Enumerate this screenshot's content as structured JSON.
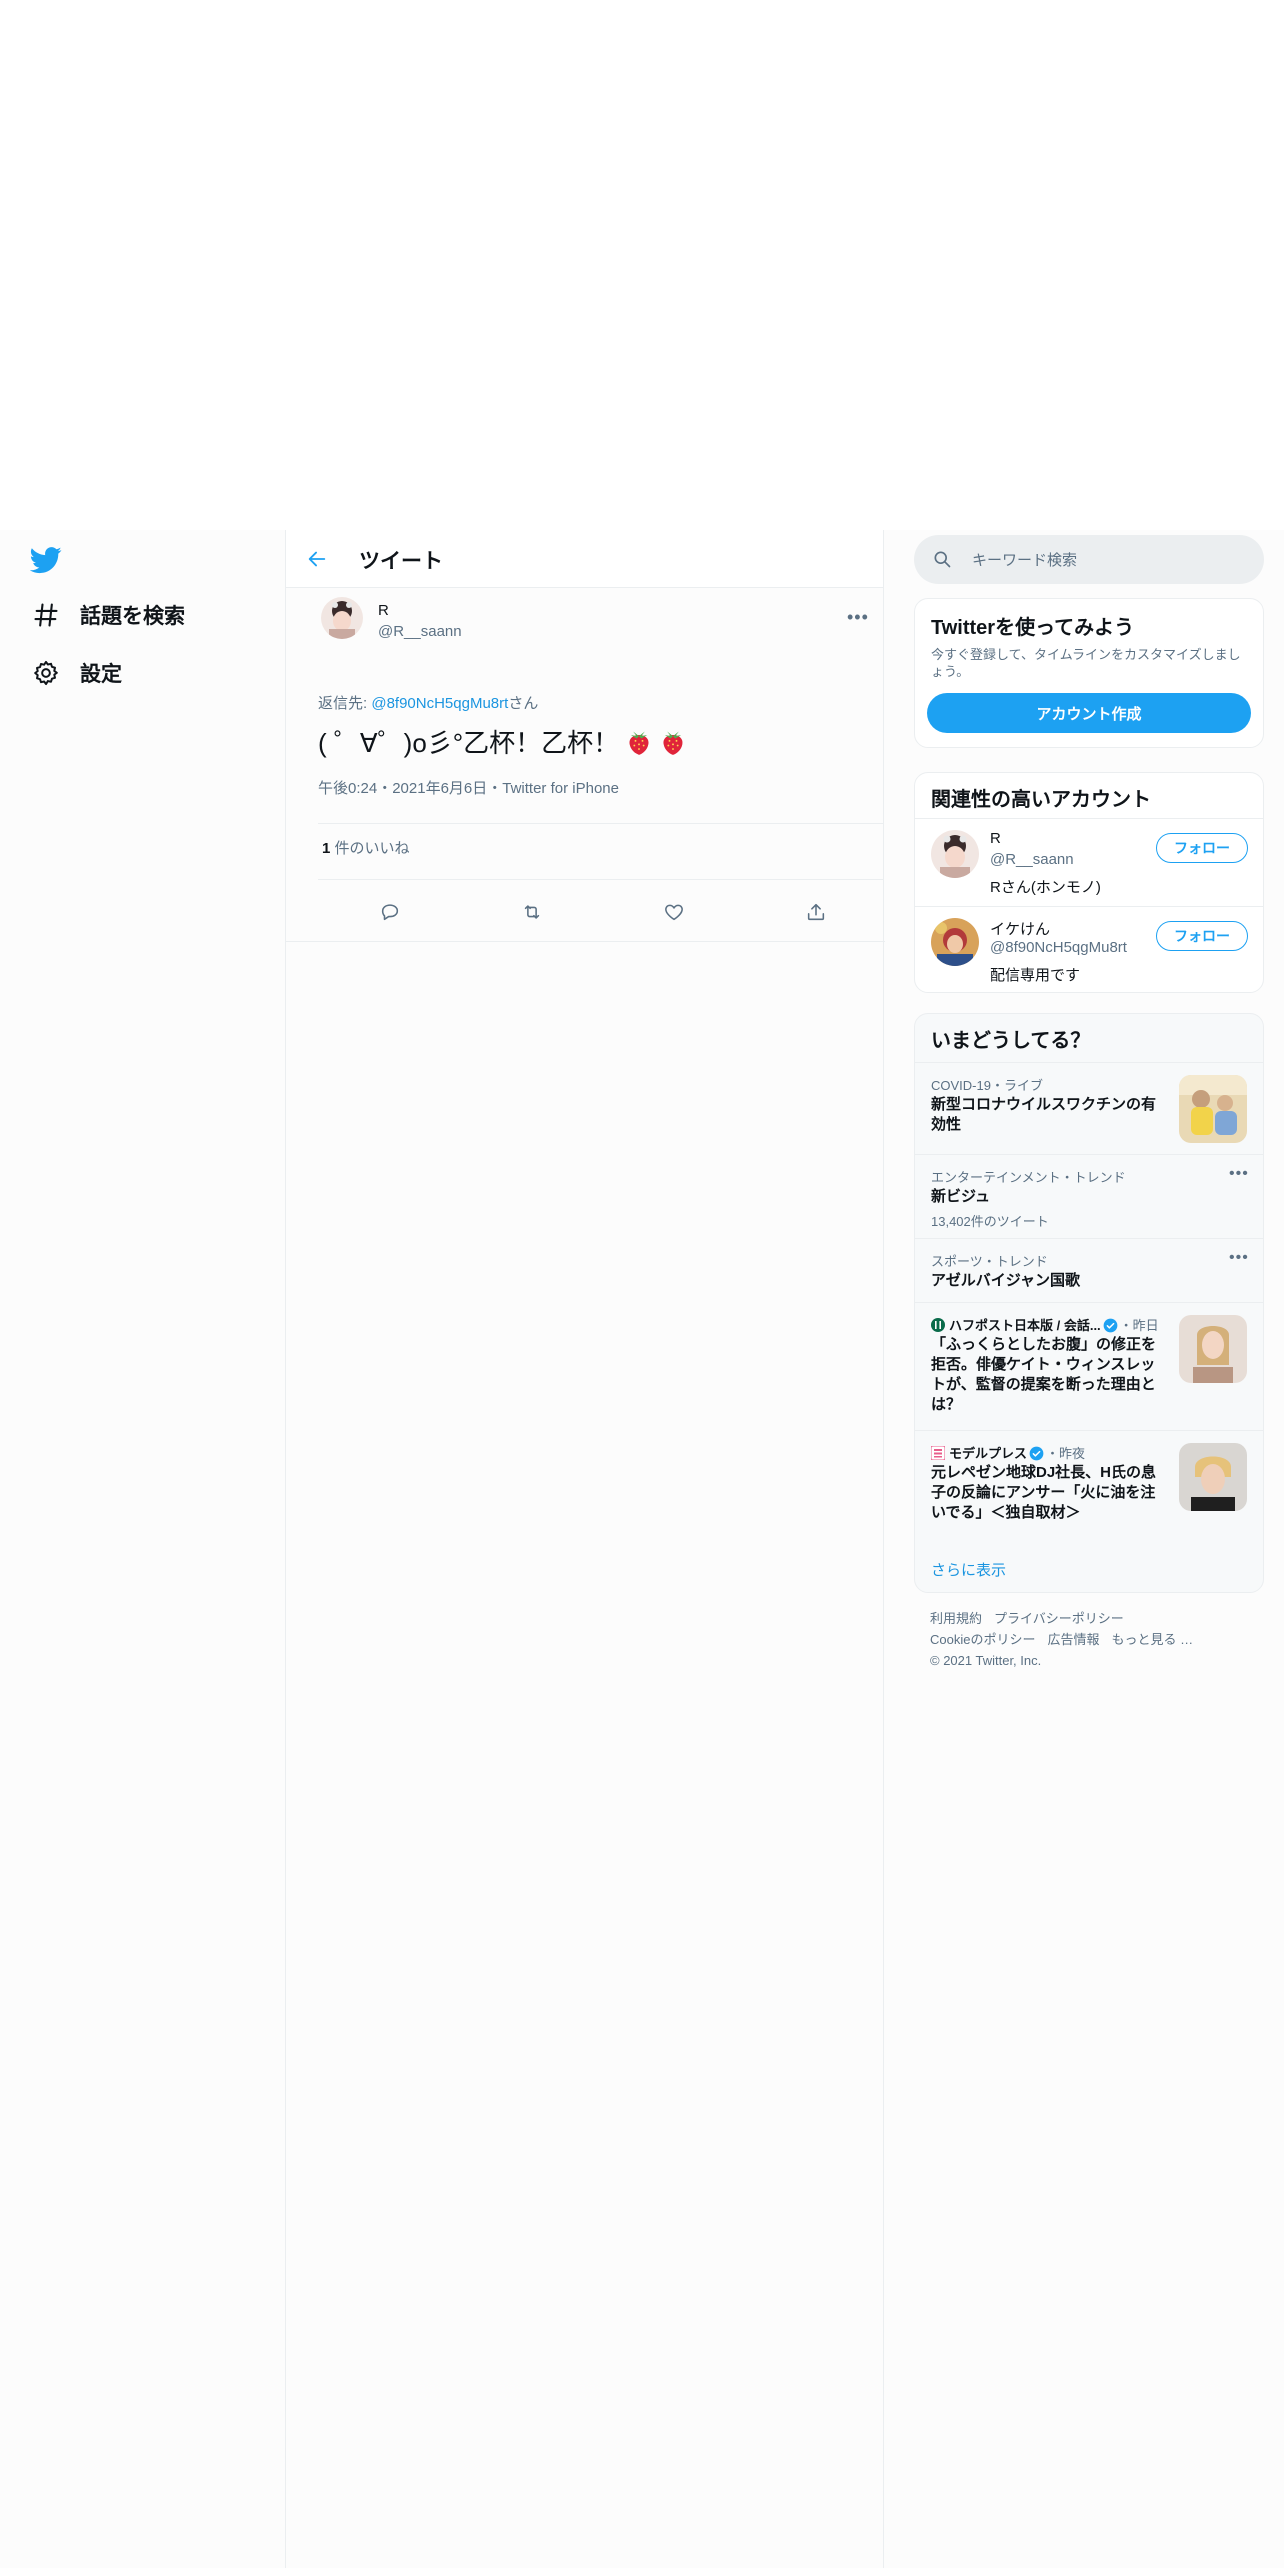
{
  "nav": {
    "items": [
      {
        "label": "話題を検索",
        "icon": "hashtag-icon"
      },
      {
        "label": "設定",
        "icon": "gear-icon"
      }
    ]
  },
  "header": {
    "title": "ツイート"
  },
  "tweet": {
    "author_name": "R",
    "author_handle": "@R__saann",
    "reply_prefix": "返信先: ",
    "reply_handle": "@8f90NcH5qgMu8rt",
    "reply_suffix": "さん",
    "text": "( ゜∀゜)o彡°乙杯！乙杯！",
    "meta": "午後0:24・2021年6月6日・Twitter for iPhone",
    "likes_count": "1",
    "likes_label": " 件のいいね"
  },
  "search": {
    "placeholder": "キーワード検索"
  },
  "signup": {
    "title": "Twitterを使ってみよう",
    "desc": "今すぐ登録して、タイムラインをカスタマイズしましょう。",
    "button": "アカウント作成"
  },
  "related": {
    "title": "関連性の高いアカウント",
    "accounts": [
      {
        "name": "R",
        "handle": "@R__saann",
        "bio": "Rさん(ホンモノ)",
        "button": "フォロー"
      },
      {
        "name": "イケけん",
        "handle": "@8f90NcH5qgMu8rt",
        "bio": "配信専用です",
        "button": "フォロー"
      }
    ]
  },
  "trends": {
    "title": "いまどうしてる？",
    "items": [
      {
        "meta": "COVID-19・ライブ",
        "title": "新型コロナウイルスワクチンの有効性"
      },
      {
        "meta": "エンターテインメント・トレンド",
        "title": "新ビジュ",
        "count": "13,402件のツイート"
      },
      {
        "meta": "スポーツ・トレンド",
        "title": "アゼルバイジャン国歌"
      },
      {
        "source": "ハフポスト日本版 / 会話...",
        "time": "・昨日",
        "title": "「ふっくらとしたお腹」の修正を拒否。俳優ケイト・ウィンスレットが、監督の提案を断った理由とは？"
      },
      {
        "source": "モデルプレス",
        "time": "・昨夜",
        "title": "元レペゼン地球DJ社長、H氏の息子の反論にアンサー「火に油を注いでる」＜独自取材＞"
      }
    ],
    "show_more": "さらに表示"
  },
  "footer": {
    "links": [
      "利用規約",
      "プライバシーポリシー",
      "Cookieのポリシー",
      "広告情報",
      "もっと見る …"
    ],
    "copyright": "© 2021 Twitter, Inc."
  },
  "colors": {
    "accent": "#1da1f2",
    "link": "#1b95e0",
    "secondary_text": "#5b7083"
  }
}
